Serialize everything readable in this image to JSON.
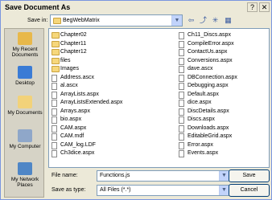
{
  "window": {
    "title": "Save Document As",
    "help_label": "?",
    "close_label": "✕"
  },
  "save_in": {
    "label": "Save in:",
    "value": "BegWebMatrix"
  },
  "places": [
    {
      "label": "My Recent Documents",
      "icon": "recent-documents-icon",
      "color": "#E8B84A"
    },
    {
      "label": "Desktop",
      "icon": "desktop-icon",
      "color": "#3A7BD5"
    },
    {
      "label": "My Documents",
      "icon": "my-documents-icon",
      "color": "#F2D27A"
    },
    {
      "label": "My Computer",
      "icon": "my-computer-icon",
      "color": "#8FA7C9"
    },
    {
      "label": "My Network Places",
      "icon": "network-places-icon",
      "color": "#4F86C6"
    }
  ],
  "files_col1": [
    {
      "name": "Chapter02",
      "type": "folder"
    },
    {
      "name": "Chapter11",
      "type": "folder"
    },
    {
      "name": "Chapter12",
      "type": "folder"
    },
    {
      "name": "files",
      "type": "folder"
    },
    {
      "name": "Images",
      "type": "folder"
    },
    {
      "name": "Address.ascx",
      "type": "file"
    },
    {
      "name": "al.ascx",
      "type": "file"
    },
    {
      "name": "ArrayLists.aspx",
      "type": "file"
    },
    {
      "name": "ArrayListsExtended.aspx",
      "type": "file"
    },
    {
      "name": "Arrays.aspx",
      "type": "file"
    },
    {
      "name": "bio.aspx",
      "type": "file"
    },
    {
      "name": "CAM.aspx",
      "type": "file"
    },
    {
      "name": "CAM.mdf",
      "type": "file"
    },
    {
      "name": "CAM_log.LDF",
      "type": "file"
    },
    {
      "name": "Ch3dice.aspx",
      "type": "file"
    }
  ],
  "files_col2": [
    {
      "name": "Ch11_Discs.aspx",
      "type": "file"
    },
    {
      "name": "CompileError.aspx",
      "type": "file"
    },
    {
      "name": "ContactUs.aspx",
      "type": "file"
    },
    {
      "name": "Conversions.aspx",
      "type": "file"
    },
    {
      "name": "dave.ascx",
      "type": "file"
    },
    {
      "name": "DBConnection.aspx",
      "type": "file"
    },
    {
      "name": "Debugging.aspx",
      "type": "file"
    },
    {
      "name": "Default.aspx",
      "type": "file"
    },
    {
      "name": "dice.aspx",
      "type": "file"
    },
    {
      "name": "DiscDetails.aspx",
      "type": "file"
    },
    {
      "name": "Discs.aspx",
      "type": "file"
    },
    {
      "name": "Downloads.aspx",
      "type": "file"
    },
    {
      "name": "EditableGrid.aspx",
      "type": "file"
    },
    {
      "name": "Error.aspx",
      "type": "file"
    },
    {
      "name": "Events.aspx",
      "type": "file"
    }
  ],
  "file_name": {
    "label": "File name:",
    "value": "Functions.js"
  },
  "save_as_type": {
    "label": "Save as type:",
    "value": "All Files (*.*)"
  },
  "buttons": {
    "save": "Save",
    "cancel": "Cancel"
  },
  "colors": {
    "dialog_bg": "#ECE9D8",
    "places_bg": "#D6D3C6",
    "folder": "#F6D77B",
    "border_blue": "#7F9DB9"
  }
}
